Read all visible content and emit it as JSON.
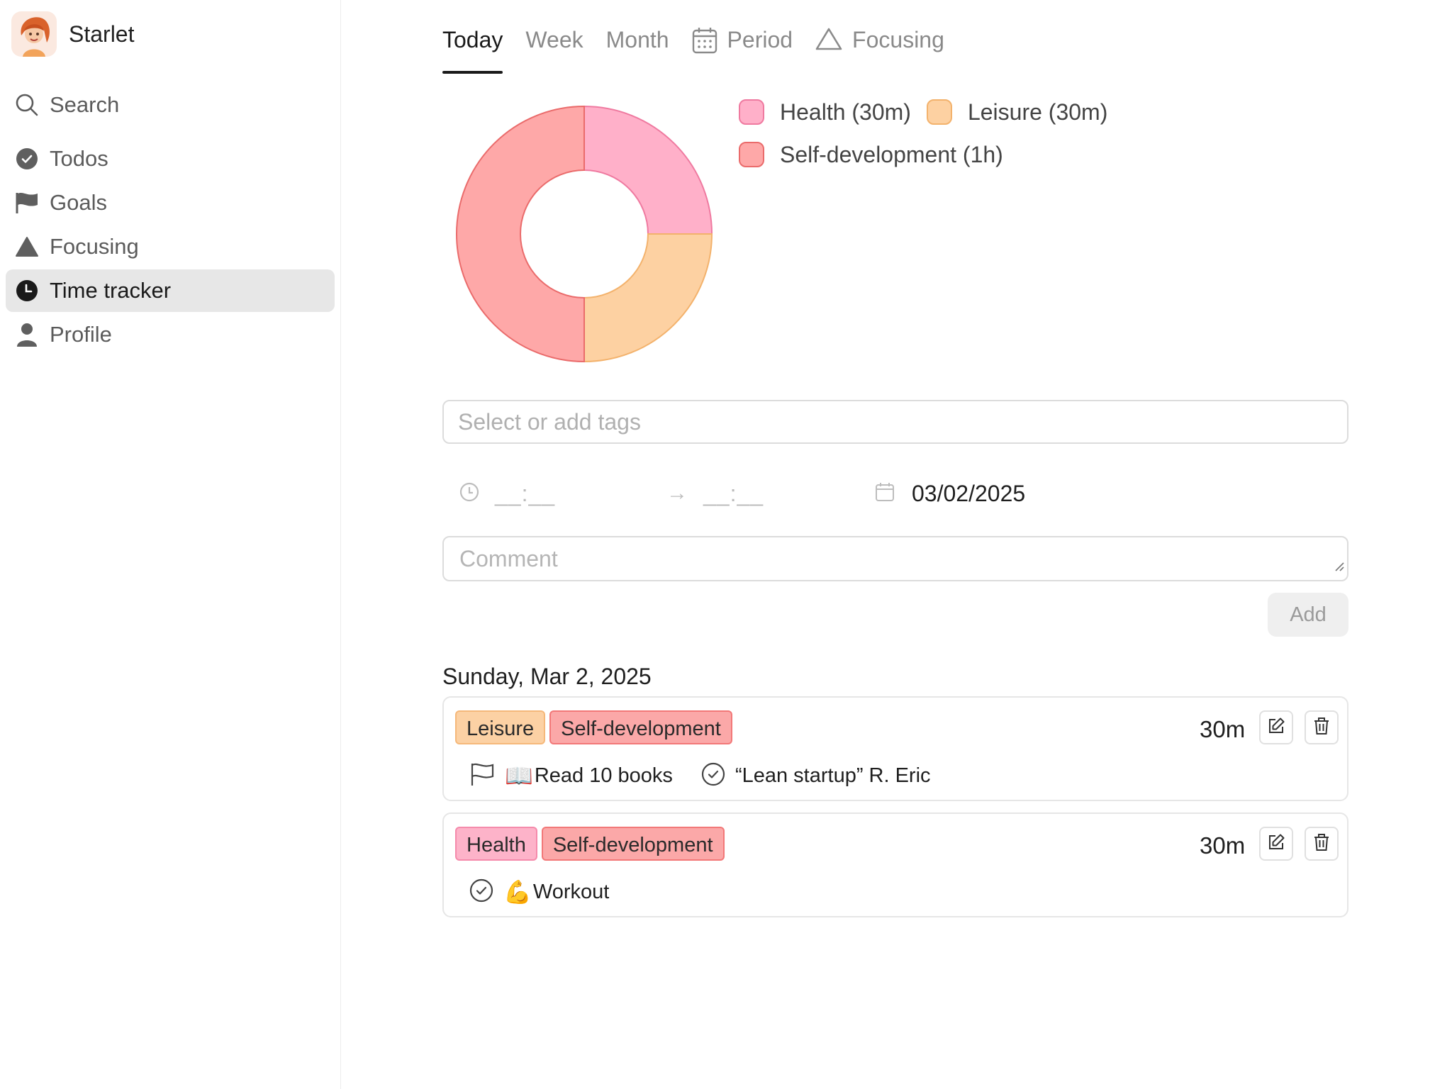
{
  "app": {
    "name": "Starlet"
  },
  "sidebar": {
    "search_label": "Search",
    "items": [
      {
        "label": "Todos",
        "icon": "check-circle-icon",
        "active": false
      },
      {
        "label": "Goals",
        "icon": "flag-icon",
        "active": false
      },
      {
        "label": "Focusing",
        "icon": "triangle-icon",
        "active": false
      },
      {
        "label": "Time tracker",
        "icon": "clock-icon",
        "active": true
      },
      {
        "label": "Profile",
        "icon": "person-icon",
        "active": false
      }
    ]
  },
  "tabs": [
    {
      "label": "Today",
      "active": true
    },
    {
      "label": "Week",
      "active": false
    },
    {
      "label": "Month",
      "active": false
    },
    {
      "label": "Period",
      "active": false,
      "icon": "calendar-icon"
    },
    {
      "label": "Focusing",
      "active": false,
      "icon": "triangle-outline-icon"
    }
  ],
  "chart_data": {
    "type": "pie",
    "donut": true,
    "categories": [
      "Health",
      "Leisure",
      "Self-development"
    ],
    "values": [
      30,
      30,
      60
    ],
    "unit": "minutes",
    "legend": [
      "Health (30m)",
      "Leisure (30m)",
      "Self-development (1h)"
    ],
    "colors": {
      "fill": [
        "#ffb0c9",
        "#fdd1a2",
        "#fea8a8"
      ],
      "stroke": [
        "#ef7aa0",
        "#f3b26c",
        "#ea6b6b"
      ]
    },
    "legend_position": "right"
  },
  "form": {
    "tags_placeholder": "Select or add tags",
    "start_time_placeholder": "__:__",
    "end_time_placeholder": "__:__",
    "arrow": "→",
    "date_value": "03/02/2025",
    "comment_placeholder": "Comment",
    "add_label": "Add"
  },
  "log": {
    "day_header": "Sunday, Mar 2, 2025",
    "entries": [
      {
        "tags": [
          "Leisure",
          "Self-development"
        ],
        "duration": "30m",
        "links": [
          {
            "icon": "flag-outline-icon",
            "emoji": "📖",
            "text": "Read 10 books"
          },
          {
            "icon": "check-circle-outline-icon",
            "emoji": "",
            "text": "“Lean startup” R. Eric"
          }
        ]
      },
      {
        "tags": [
          "Health",
          "Self-development"
        ],
        "duration": "30m",
        "links": [
          {
            "icon": "check-circle-outline-icon",
            "emoji": "💪",
            "text": "Workout"
          }
        ]
      }
    ]
  }
}
